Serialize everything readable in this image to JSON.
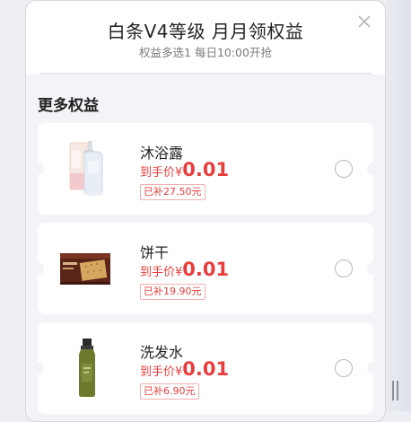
{
  "modal": {
    "title": "白条V4等级 月月领权益",
    "subtitle": "权益多选1 每日10:00开抢",
    "section_title": "更多权益"
  },
  "items": [
    {
      "name": "沐浴露",
      "price_label": "到手价",
      "currency": "¥",
      "price": "0.01",
      "subsidy": "已补27.50元",
      "icon": "body-wash-bottle-icon"
    },
    {
      "name": "饼干",
      "price_label": "到手价",
      "currency": "¥",
      "price": "0.01",
      "subsidy": "已补19.90元",
      "icon": "biscuit-box-icon"
    },
    {
      "name": "洗发水",
      "price_label": "到手价",
      "currency": "¥",
      "price": "0.01",
      "subsidy": "已补6.90元",
      "icon": "shampoo-bottle-icon"
    }
  ],
  "colors": {
    "accent": "#e83d3d",
    "background": "#f3f3f8",
    "card": "#ffffff"
  }
}
